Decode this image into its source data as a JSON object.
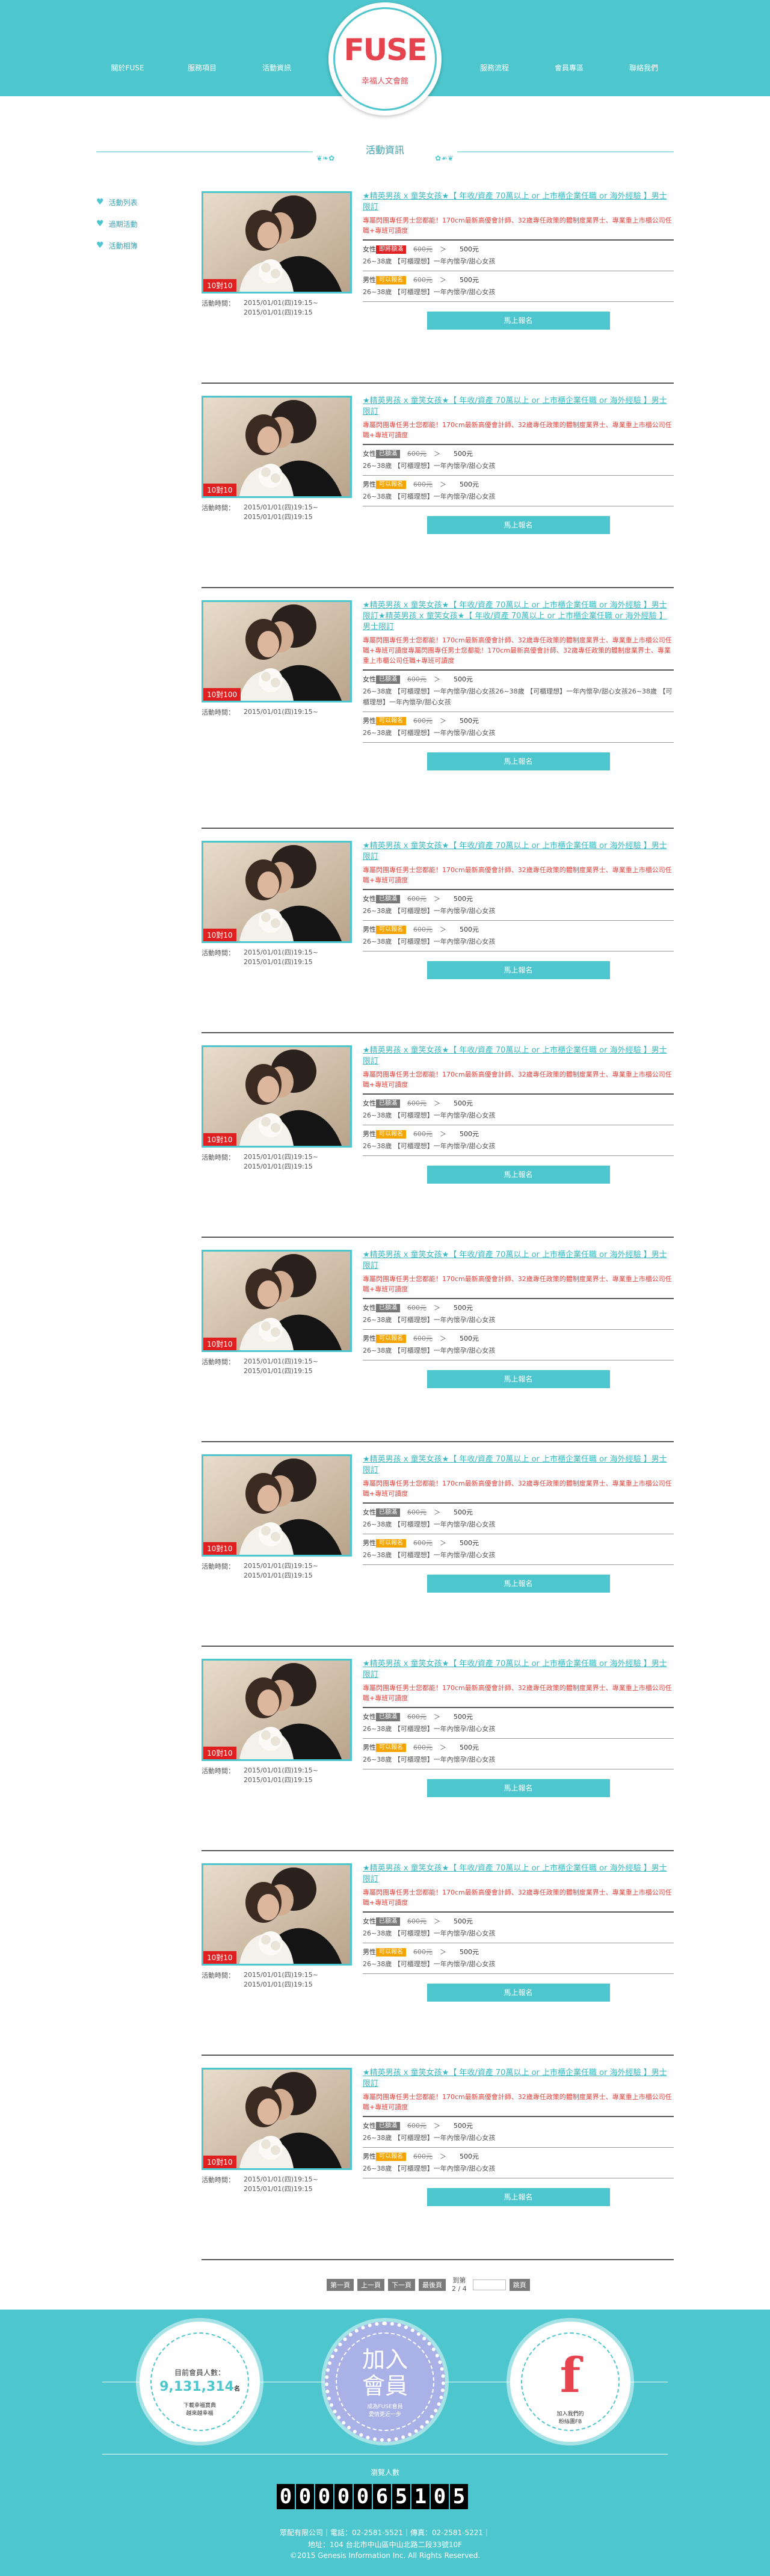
{
  "header": {
    "nav_left": [
      "關於FUSE",
      "服務項目",
      "活動資訊"
    ],
    "nav_right": [
      "服務流程",
      "會員專區",
      "聯絡我們"
    ],
    "logo_word": "FUSE",
    "logo_sub": "幸福人文會館"
  },
  "section": {
    "title": "活動資訊"
  },
  "sidebar": {
    "items": [
      "活動列表",
      "過期活動",
      "活動相簿"
    ]
  },
  "common": {
    "time_label": "活動時間：",
    "signup": "馬上報名",
    "arrow": "＞",
    "female": "女性",
    "male": "男性"
  },
  "events": [
    {
      "title": "★精英男孩 x 童笑女孩★【 年收/資產 70萬以上 or 上市櫃企業任職 or 海外經驗 】男士限訂",
      "desc": "專屬閃團專任男士您都能！170cm最新高優會計師、32歲專任政策的體制度業界士、專業重上市櫃公司任職+專班可讀度",
      "count": "10對10",
      "time": "2015/01/01(四)19:15~\n2015/01/01(四)19:15",
      "f_badge": "即將額滿",
      "f_badge_color": "red",
      "f_orig": "600元",
      "f_price": "500元",
      "f_age": "26~38歲 【可櫃理想】一年內懷孕/甜心女孩",
      "m_badge": "可以報名",
      "m_badge_color": "orange",
      "m_orig": "600元",
      "m_price": "500元",
      "m_age": "26~38歲 【可櫃理想】一年內懷孕/甜心女孩"
    },
    {
      "title": "★精英男孩 x 童笑女孩★【 年收/資產 70萬以上 or 上市櫃企業任職 or 海外經驗 】男士限訂",
      "desc": "專屬閃團專任男士您都能！170cm最新高優會計師、32歲專任政策的體制度業界士、專業重上市櫃公司任職+專班可讀度",
      "count": "10對10",
      "time": "2015/01/01(四)19:15~\n2015/01/01(四)19:15",
      "f_badge": "已額滿",
      "f_badge_color": "gray",
      "f_orig": "600元",
      "f_price": "500元",
      "f_age": "26~38歲 【可櫃理想】一年內懷孕/甜心女孩",
      "m_badge": "可以報名",
      "m_badge_color": "orange",
      "m_orig": "600元",
      "m_price": "500元",
      "m_age": "26~38歲 【可櫃理想】一年內懷孕/甜心女孩"
    },
    {
      "title": "★精英男孩 x 童笑女孩★【 年收/資產 70萬以上 or 上市櫃企業任職 or 海外經驗 】男士限訂★精英男孩 x 童笑女孩★【 年收/資產 70萬以上 or 上市櫃企業任職 or 海外經驗 】男士限訂",
      "desc": "專屬閃團專任男士您都能！170cm最新高優會計師、32歲專任政策的體制度業界士、專業重上市櫃公司任職+專班可讀度專屬閃團專任男士您都能！170cm最新高優會計師、32歲專任政策的體制度業界士、專業重上市櫃公司任職+專班可讀度",
      "count": "10對100",
      "time": "2015/01/01(四)19:15~",
      "f_badge": "已額滿",
      "f_badge_color": "gray",
      "f_orig": "600元",
      "f_price": "500元",
      "f_age": "26~38歲 【可櫃理想】一年內懷孕/甜心女孩26~38歲 【可櫃理想】一年內懷孕/甜心女孩26~38歲 【可櫃理想】一年內懷孕/甜心女孩",
      "m_badge": "可以報名",
      "m_badge_color": "orange",
      "m_orig": "600元",
      "m_price": "500元",
      "m_age": "26~38歲 【可櫃理想】一年內懷孕/甜心女孩"
    },
    {
      "title": "★精英男孩 x 童笑女孩★【 年收/資產 70萬以上 or 上市櫃企業任職 or 海外經驗 】男士限訂",
      "desc": "專屬閃團專任男士您都能！170cm最新高優會計師、32歲專任政策的體制度業界士、專業重上市櫃公司任職+專班可讀度",
      "count": "10對10",
      "time": "2015/01/01(四)19:15~\n2015/01/01(四)19:15",
      "f_badge": "已額滿",
      "f_badge_color": "gray",
      "f_orig": "600元",
      "f_price": "500元",
      "f_age": "26~38歲 【可櫃理想】一年內懷孕/甜心女孩",
      "m_badge": "可以報名",
      "m_badge_color": "orange",
      "m_orig": "600元",
      "m_price": "500元",
      "m_age": "26~38歲 【可櫃理想】一年內懷孕/甜心女孩"
    },
    {
      "title": "★精英男孩 x 童笑女孩★【 年收/資產 70萬以上 or 上市櫃企業任職 or 海外經驗 】男士限訂",
      "desc": "專屬閃團專任男士您都能！170cm最新高優會計師、32歲專任政策的體制度業界士、專業重上市櫃公司任職+專班可讀度",
      "count": "10對10",
      "time": "2015/01/01(四)19:15~\n2015/01/01(四)19:15",
      "f_badge": "已額滿",
      "f_badge_color": "gray",
      "f_orig": "600元",
      "f_price": "500元",
      "f_age": "26~38歲 【可櫃理想】一年內懷孕/甜心女孩",
      "m_badge": "可以報名",
      "m_badge_color": "orange",
      "m_orig": "600元",
      "m_price": "500元",
      "m_age": "26~38歲 【可櫃理想】一年內懷孕/甜心女孩"
    },
    {
      "title": "★精英男孩 x 童笑女孩★【 年收/資產 70萬以上 or 上市櫃企業任職 or 海外經驗 】男士限訂",
      "desc": "專屬閃團專任男士您都能！170cm最新高優會計師、32歲專任政策的體制度業界士、專業重上市櫃公司任職+專班可讀度",
      "count": "10對10",
      "time": "2015/01/01(四)19:15~\n2015/01/01(四)19:15",
      "f_badge": "已額滿",
      "f_badge_color": "gray",
      "f_orig": "600元",
      "f_price": "500元",
      "f_age": "26~38歲 【可櫃理想】一年內懷孕/甜心女孩",
      "m_badge": "可以報名",
      "m_badge_color": "orange",
      "m_orig": "600元",
      "m_price": "500元",
      "m_age": "26~38歲 【可櫃理想】一年內懷孕/甜心女孩"
    },
    {
      "title": "★精英男孩 x 童笑女孩★【 年收/資產 70萬以上 or 上市櫃企業任職 or 海外經驗 】男士限訂",
      "desc": "專屬閃團專任男士您都能！170cm最新高優會計師、32歲專任政策的體制度業界士、專業重上市櫃公司任職+專班可讀度",
      "count": "10對10",
      "time": "2015/01/01(四)19:15~\n2015/01/01(四)19:15",
      "f_badge": "已額滿",
      "f_badge_color": "gray",
      "f_orig": "600元",
      "f_price": "500元",
      "f_age": "26~38歲 【可櫃理想】一年內懷孕/甜心女孩",
      "m_badge": "可以報名",
      "m_badge_color": "orange",
      "m_orig": "600元",
      "m_price": "500元",
      "m_age": "26~38歲 【可櫃理想】一年內懷孕/甜心女孩"
    },
    {
      "title": "★精英男孩 x 童笑女孩★【 年收/資產 70萬以上 or 上市櫃企業任職 or 海外經驗 】男士限訂",
      "desc": "專屬閃團專任男士您都能！170cm最新高優會計師、32歲專任政策的體制度業界士、專業重上市櫃公司任職+專班可讀度",
      "count": "10對10",
      "time": "2015/01/01(四)19:15~\n2015/01/01(四)19:15",
      "f_badge": "已額滿",
      "f_badge_color": "gray",
      "f_orig": "600元",
      "f_price": "500元",
      "f_age": "26~38歲 【可櫃理想】一年內懷孕/甜心女孩",
      "m_badge": "可以報名",
      "m_badge_color": "orange",
      "m_orig": "600元",
      "m_price": "500元",
      "m_age": "26~38歲 【可櫃理想】一年內懷孕/甜心女孩"
    },
    {
      "title": "★精英男孩 x 童笑女孩★【 年收/資產 70萬以上 or 上市櫃企業任職 or 海外經驗 】男士限訂",
      "desc": "專屬閃團專任男士您都能！170cm最新高優會計師、32歲專任政策的體制度業界士、專業重上市櫃公司任職+專班可讀度",
      "count": "10對10",
      "time": "2015/01/01(四)19:15~\n2015/01/01(四)19:15",
      "f_badge": "已額滿",
      "f_badge_color": "gray",
      "f_orig": "600元",
      "f_price": "500元",
      "f_age": "26~38歲 【可櫃理想】一年內懷孕/甜心女孩",
      "m_badge": "可以報名",
      "m_badge_color": "orange",
      "m_orig": "600元",
      "m_price": "500元",
      "m_age": "26~38歲 【可櫃理想】一年內懷孕/甜心女孩"
    },
    {
      "title": "★精英男孩 x 童笑女孩★【 年收/資產 70萬以上 or 上市櫃企業任職 or 海外經驗 】男士限訂",
      "desc": "專屬閃團專任男士您都能！170cm最新高優會計師、32歲專任政策的體制度業界士、專業重上市櫃公司任職+專班可讀度",
      "count": "10對10",
      "time": "2015/01/01(四)19:15~\n2015/01/01(四)19:15",
      "f_badge": "已額滿",
      "f_badge_color": "gray",
      "f_orig": "600元",
      "f_price": "500元",
      "f_age": "26~38歲 【可櫃理想】一年內懷孕/甜心女孩",
      "m_badge": "可以報名",
      "m_badge_color": "orange",
      "m_orig": "600元",
      "m_price": "500元",
      "m_age": "26~38歲 【可櫃理想】一年內懷孕/甜心女孩"
    }
  ],
  "pager": {
    "first": "第一頁",
    "prev": "上一頁",
    "next": "下一頁",
    "last": "最後頁",
    "label": "到第",
    "page_info": "2 / 4",
    "go": "跳頁"
  },
  "footer": {
    "members_label": "目前會員人數：",
    "members_count": "9,131,314",
    "members_unit": "名",
    "members_note": "下載幸福寶典\n越來越幸福",
    "join_text": "加入\n會員",
    "join_note": "成為FUSE會員\n愛情更近一步",
    "fb_letter": "f",
    "fb_note": "加入我們的\n粉絲團FB",
    "visit_label": "瀏覽人數",
    "counter_digits": [
      "0",
      "0",
      "0",
      "0",
      "0",
      "6",
      "5",
      "1",
      "0",
      "5"
    ],
    "company": "眾配有限公司｜電話：02-2581-5521｜傳真：02-2581-5221｜",
    "address": "地址：104 台北市中山區中山北路二段33號10F",
    "copyright": "©2015 Genesis Information Inc. All Rights Reserved."
  },
  "colors": {
    "accent": "#4dc7cd",
    "red": "#e02020",
    "orange": "#f5a400",
    "gray": "#777777"
  }
}
